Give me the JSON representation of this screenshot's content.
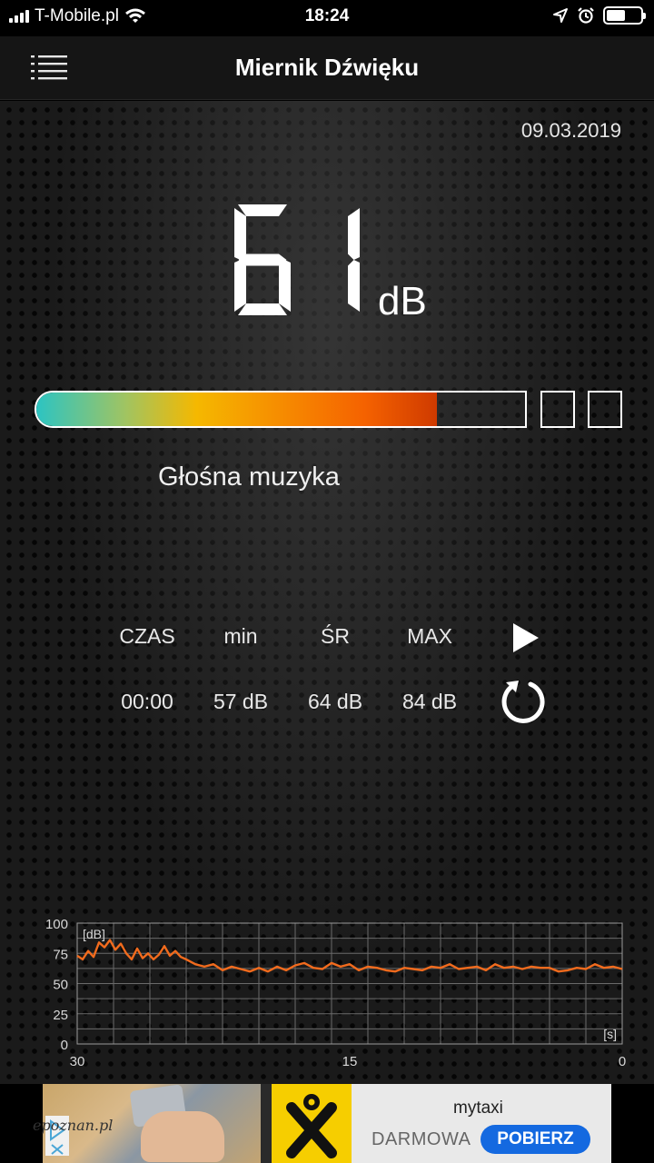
{
  "status": {
    "carrier": "T-Mobile.pl",
    "time": "18:24",
    "battery_level": 0.55
  },
  "nav": {
    "title": "Miernik Dźwięku"
  },
  "meter": {
    "date": "09.03.2019",
    "reading": "61",
    "unit": "dB",
    "level_fraction": 0.82,
    "level_description": "Głośna muzyka"
  },
  "stats": {
    "labels": [
      "CZAS",
      "min",
      "ŚR",
      "MAX"
    ],
    "values": [
      "00:00",
      "57 dB",
      "64 dB",
      "84 dB"
    ]
  },
  "chart_data": {
    "type": "line",
    "ylabel": "[dB]",
    "xlabel": "[s]",
    "ylim": [
      0,
      100
    ],
    "xlim": [
      30,
      0
    ],
    "y_ticks": [
      "100",
      "75",
      "50",
      "25",
      "0"
    ],
    "x_ticks": [
      "30",
      "15",
      "0"
    ],
    "grid": true,
    "color": "#f26b1d",
    "series": [
      {
        "x": [
          30.0,
          29.7,
          29.4,
          29.1,
          28.8,
          28.5,
          28.2,
          27.9,
          27.6,
          27.3,
          27.0,
          26.7,
          26.4,
          26.1,
          25.8,
          25.5,
          25.2,
          24.9,
          24.6,
          24.3,
          24.0,
          23.5,
          23.0,
          22.5,
          22.0,
          21.5,
          21.0,
          20.5,
          20.0,
          19.5,
          19.0,
          18.5,
          18.0,
          17.5,
          17.0,
          16.5,
          16.0,
          15.5,
          15.0,
          14.5,
          14.0,
          13.5,
          13.0,
          12.5,
          12.0,
          11.5,
          11.0,
          10.5,
          10.0,
          9.5,
          9.0,
          8.5,
          8.0,
          7.5,
          7.0,
          6.5,
          6.0,
          5.5,
          5.0,
          4.5,
          4.0,
          3.5,
          3.0,
          2.5,
          2.0,
          1.5,
          1.0,
          0.5,
          0.0
        ],
        "y": [
          73,
          70,
          77,
          72,
          84,
          80,
          86,
          78,
          83,
          75,
          70,
          79,
          71,
          75,
          70,
          74,
          81,
          73,
          77,
          72,
          70,
          66,
          64,
          66,
          61,
          64,
          62,
          60,
          63,
          60,
          64,
          61,
          65,
          67,
          63,
          62,
          67,
          64,
          66,
          61,
          64,
          63,
          61,
          60,
          63,
          62,
          61,
          64,
          63,
          66,
          62,
          63,
          64,
          61,
          66,
          63,
          64,
          62,
          64,
          63,
          63,
          60,
          61,
          63,
          62,
          66,
          63,
          64,
          62
        ]
      }
    ]
  },
  "ad": {
    "brand": "mytaxi",
    "text": "DARMOWA",
    "cta": "POBIERZ",
    "watermark": "epoznan.pl",
    "brand_color": "#f6ce00",
    "cta_color": "#1469e0"
  }
}
